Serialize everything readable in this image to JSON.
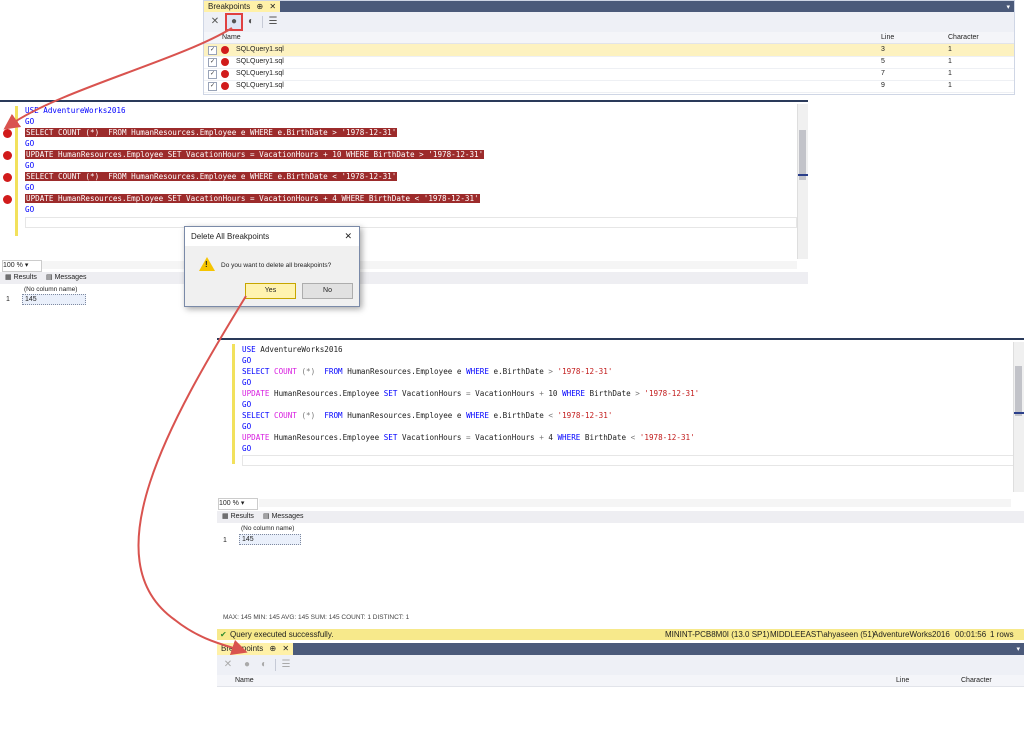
{
  "breakpoints_top": {
    "tab_title": "Breakpoints",
    "pin_glyph": "⊕",
    "close_glyph": "✕",
    "col_name": "Name",
    "col_line": "Line",
    "col_character": "Character",
    "rows": [
      {
        "name": "SQLQuery1.sql",
        "line": "3",
        "character": "1"
      },
      {
        "name": "SQLQuery1.sql",
        "line": "5",
        "character": "1"
      },
      {
        "name": "SQLQuery1.sql",
        "line": "7",
        "character": "1"
      },
      {
        "name": "SQLQuery1.sql",
        "line": "9",
        "character": "1"
      }
    ]
  },
  "editor1": {
    "lines": [
      {
        "text": "USE AdventureWorks2016",
        "bp": false
      },
      {
        "text": "GO",
        "bp": false
      },
      {
        "text": "SELECT COUNT (*)  FROM HumanResources.Employee e WHERE e.BirthDate > '1978-12-31'",
        "bp": true
      },
      {
        "text": "GO",
        "bp": false
      },
      {
        "text": "UPDATE HumanResources.Employee SET VacationHours = VacationHours + 10 WHERE BirthDate > '1978-12-31'",
        "bp": true
      },
      {
        "text": "GO",
        "bp": false
      },
      {
        "text": "SELECT COUNT (*)  FROM HumanResources.Employee e WHERE e.BirthDate < '1978-12-31'",
        "bp": true
      },
      {
        "text": "GO",
        "bp": false
      },
      {
        "text": "UPDATE HumanResources.Employee SET VacationHours = VacationHours + 4 WHERE BirthDate < '1978-12-31'",
        "bp": true
      },
      {
        "text": "GO",
        "bp": false
      }
    ],
    "zoom": "100 %",
    "tab_results": "Results",
    "tab_messages": "Messages",
    "col_header": "(No column name)",
    "row_num": "1",
    "value": "145"
  },
  "dialog": {
    "title": "Delete All Breakpoints",
    "message": "Do you want to delete all breakpoints?",
    "yes": "Yes",
    "no": "No",
    "close_glyph": "✕",
    "warning_glyph": "!"
  },
  "editor2": {
    "zoom": "100 %",
    "tab_results": "Results",
    "tab_messages": "Messages",
    "col_header": "(No column name)",
    "row_num": "1",
    "value": "145",
    "stats": "MAX:  145   MIN:  145   AVG:  145   SUM:  145   COUNT:  1      DISTINCT:  1",
    "status_message": "Query executed successfully.",
    "status_server": "MININT-PCB8M0I (13.0 SP1)",
    "status_user": "MIDDLEEAST\\ahyaseen (51)",
    "status_db": "AdventureWorks2016",
    "status_time": "00:01:56",
    "status_rows": "1 rows"
  },
  "breakpoints_bottom": {
    "tab_title": "Breakpoints",
    "pin_glyph": "⊕",
    "close_glyph": "✕",
    "col_name": "Name",
    "col_line": "Line",
    "col_character": "Character"
  },
  "colors": {
    "breakpoint_red": "#d11b1b",
    "highlight_bg": "#9c2b2b",
    "arrow_red": "#d9534f",
    "status_yellow": "#f7e98b",
    "titlebar_navy": "#2a3a5a"
  }
}
